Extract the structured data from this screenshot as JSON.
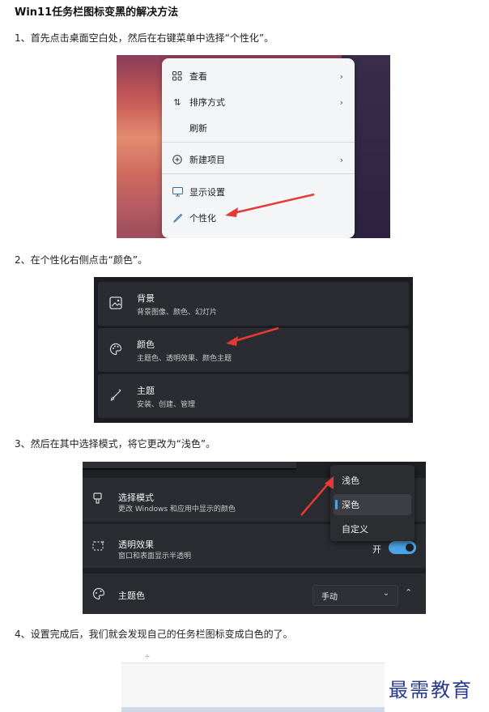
{
  "title": "Win11任务栏图标变黑的解决方法",
  "steps": [
    "1、首先点击桌面空白处，然后在右键菜单中选择“个性化”。",
    "2、在个性化右侧点击“颜色”。",
    "3、然后在其中选择模式，将它更改为“浅色”。",
    "4、设置完成后，我们就会发现自己的任务栏图标变成白色的了。"
  ],
  "context_menu": {
    "items": [
      {
        "label": "查看",
        "icon": "grid-icon",
        "has_submenu": true
      },
      {
        "label": "排序方式",
        "icon": "sort-icon",
        "has_submenu": true
      },
      {
        "label": "刷新",
        "icon": "",
        "has_submenu": false
      },
      {
        "label": "新建项目",
        "icon": "plus-circle-icon",
        "has_submenu": true
      },
      {
        "label": "显示设置",
        "icon": "display-icon",
        "has_submenu": false
      },
      {
        "label": "个性化",
        "icon": "brush-icon",
        "has_submenu": false
      }
    ]
  },
  "personalization": {
    "rows": [
      {
        "title": "背景",
        "subtitle": "背景图像、颜色、幻灯片",
        "icon": "image-icon"
      },
      {
        "title": "颜色",
        "subtitle": "主题色、透明效果、颜色主题",
        "icon": "palette-icon"
      },
      {
        "title": "主题",
        "subtitle": "安装、创建、管理",
        "icon": "brush-icon"
      }
    ]
  },
  "colors": {
    "mode": {
      "title": "选择模式",
      "subtitle": "更改 Windows 和应用中显示的颜色"
    },
    "mode_options": [
      "浅色",
      "深色",
      "自定义"
    ],
    "mode_selected": "深色",
    "transparency": {
      "title": "透明效果",
      "subtitle": "窗口和表面显示半透明",
      "toggle_label": "开",
      "on": true
    },
    "accent": {
      "title": "主题色",
      "value": "手动"
    }
  },
  "watermark": "最需教育",
  "accent_color": "#4aa4e6",
  "arrow_color": "#e53935"
}
